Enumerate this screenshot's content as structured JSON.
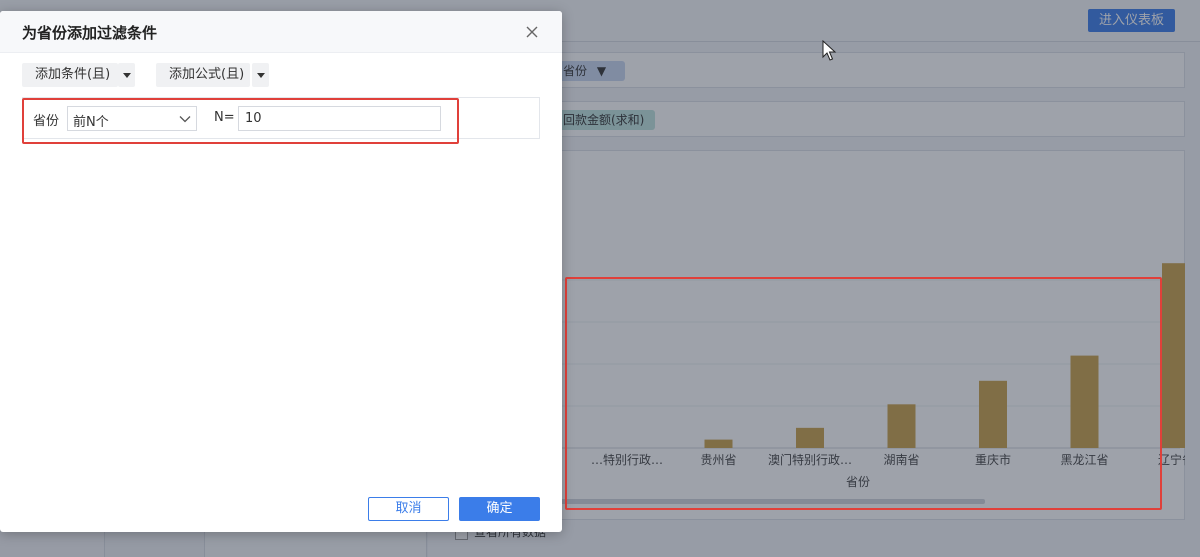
{
  "app": {
    "enter_dashboard": "进入仪表板",
    "province_pill": "省份",
    "amount_pill": "回款金额(求和)",
    "view_all": "查看所有数据"
  },
  "chart_data": {
    "type": "bar",
    "categories": [
      "…特别行政…",
      "贵州省",
      "澳门特别行政…",
      "湖南省",
      "重庆市",
      "黑龙江省",
      "辽宁省"
    ],
    "values": [
      0,
      5,
      12,
      26,
      40,
      55,
      110
    ],
    "xlabel": "省份",
    "ylabel": "",
    "ylim": [
      0,
      120
    ],
    "colors": {
      "bar": "#c9a04a"
    }
  },
  "dialog": {
    "title": "为省份添加过滤条件",
    "add_condition": "添加条件(且)",
    "add_formula": "添加公式(且)",
    "condition": {
      "field_label": "省份",
      "mode_value": "前N个",
      "n_label": "N=",
      "n_value": "10"
    },
    "cancel": "取消",
    "confirm": "确定"
  },
  "colors": {
    "primary": "#3b7de9",
    "highlight": "#e0403a"
  }
}
